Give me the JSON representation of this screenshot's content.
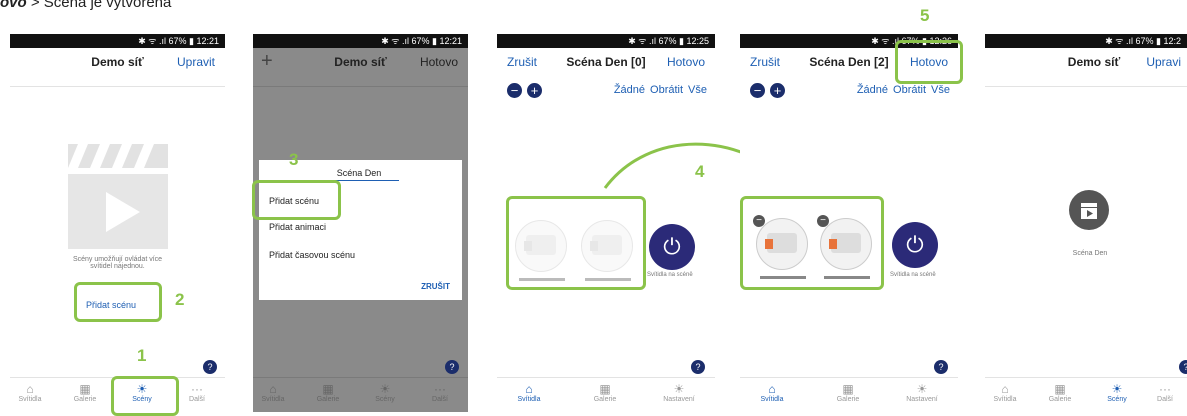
{
  "caption": {
    "bold": "ovo",
    "rest": " > Scéna je vytvořena"
  },
  "status": {
    "p1": "✱ ᯤ .ıl 67% ▮ 12:21",
    "p2": "✱ ᯤ .ıl 67% ▮ 12:21",
    "p3": "✱ ᯤ .ıl 67% ▮ 12:25",
    "p4": "✱ ᯤ .ıl 67% ▮ 12:26",
    "p5": "✱ ᯤ .ıl 67% ▮ 12:2"
  },
  "p1": {
    "title": "Demo síť",
    "edit": "Upravit",
    "desc1": "Scény umožňují ovládat více",
    "desc2": "svítidel najednou.",
    "add": "Přidat scénu"
  },
  "p2": {
    "title": "Demo síť",
    "done": "Hotovo",
    "name_value": "Scéna Den",
    "opt1": "Přidat scénu",
    "opt2": "Přidat animaci",
    "opt3": "Přidat časovou scénu",
    "cancel": "ZRUŠIT"
  },
  "p3": {
    "cancel": "Zrušit",
    "title": "Scéna Den [0]",
    "done": "Hotovo",
    "none": "Žádné",
    "invert": "Obrátit",
    "all": "Vše",
    "lights_label": "Svítidla na scéně"
  },
  "p4": {
    "cancel": "Zrušit",
    "title": "Scéna Den [2]",
    "done": "Hotovo",
    "none": "Žádné",
    "invert": "Obrátit",
    "all": "Vše",
    "lights_label": "Svítidla na scéně"
  },
  "p5": {
    "title": "Demo síť",
    "edit": "Upravi",
    "scene_name": "Scéna Den"
  },
  "tabs_a": [
    "Svítidla",
    "Galerie",
    "Scény",
    "Další"
  ],
  "tabs_b": [
    "Svítidla",
    "Galerie",
    "Nastavení"
  ],
  "steps": [
    "1",
    "2",
    "3",
    "4",
    "5"
  ],
  "help": "?",
  "icons": {
    "plus": "+",
    "minus": "−",
    "power": "⏻",
    "more": "···"
  },
  "colors": {
    "accent": "#1e5fb3",
    "green": "#8bc34a",
    "navy": "#2b2a78"
  }
}
